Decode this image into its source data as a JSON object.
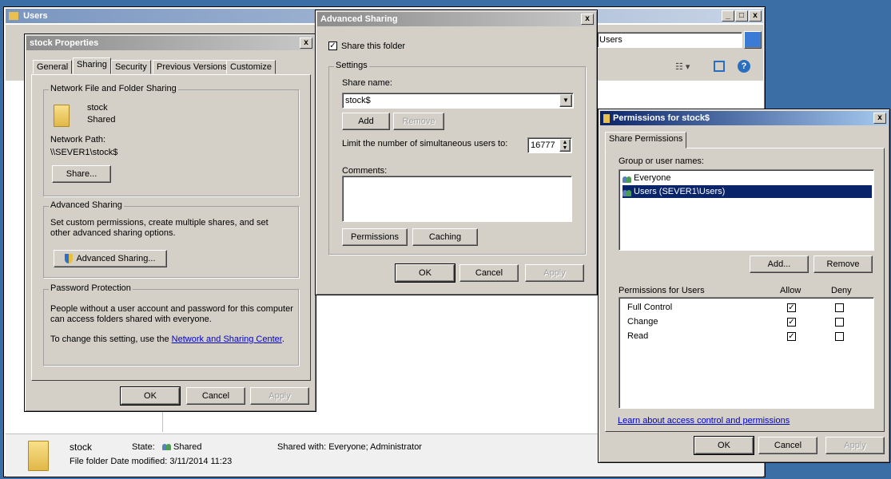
{
  "explorer": {
    "title": "Users",
    "address": "Users",
    "details": {
      "name": "stock",
      "state_label": "State:",
      "state": "Shared",
      "shared_with": "Shared with: Everyone; Administrator",
      "type_date": "File folder Date modified: 3/11/2014 11:23"
    },
    "controls": {
      "min": "_",
      "max": "□",
      "close": "x"
    }
  },
  "properties": {
    "title": "stock Properties",
    "tabs": [
      "General",
      "Sharing",
      "Security",
      "Previous Versions",
      "Customize"
    ],
    "nfs": {
      "group": "Network File and Folder Sharing",
      "name": "stock",
      "status": "Shared",
      "path_label": "Network Path:",
      "path": "\\\\SEVER1\\stock$",
      "share_btn": "Share..."
    },
    "adv": {
      "group": "Advanced Sharing",
      "desc": "Set custom permissions, create multiple shares, and set other advanced sharing options.",
      "btn": "Advanced Sharing..."
    },
    "pwd": {
      "group": "Password Protection",
      "desc": "People without a user account and password for this computer can access folders shared with everyone.",
      "change_prefix": "To change this setting, use the ",
      "link": "Network and Sharing Center",
      "suffix": "."
    },
    "ok": "OK",
    "cancel": "Cancel",
    "apply": "Apply"
  },
  "advanced": {
    "title": "Advanced Sharing",
    "share_chk": "Share this folder",
    "settings": "Settings",
    "share_name_label": "Share name:",
    "share_name": "stock$",
    "add": "Add",
    "remove": "Remove",
    "limit_label": "Limit the number of simultaneous users to:",
    "limit_value": "16777",
    "comments_label": "Comments:",
    "permissions": "Permissions",
    "caching": "Caching",
    "ok": "OK",
    "cancel": "Cancel",
    "apply": "Apply"
  },
  "perms": {
    "title": "Permissions for stock$",
    "tab": "Share Permissions",
    "group_label": "Group or user names:",
    "users": [
      "Everyone",
      "Users (SEVER1\\Users)"
    ],
    "add": "Add...",
    "remove": "Remove",
    "perm_label": "Permissions for Users",
    "allow": "Allow",
    "deny": "Deny",
    "rows": [
      {
        "name": "Full Control",
        "allow": "☑",
        "deny": ""
      },
      {
        "name": "Change",
        "allow": "☑",
        "deny": ""
      },
      {
        "name": "Read",
        "allow": "☑",
        "deny": ""
      }
    ],
    "learn": "Learn about access control and permissions",
    "ok": "OK",
    "cancel": "Cancel",
    "apply": "Apply"
  }
}
